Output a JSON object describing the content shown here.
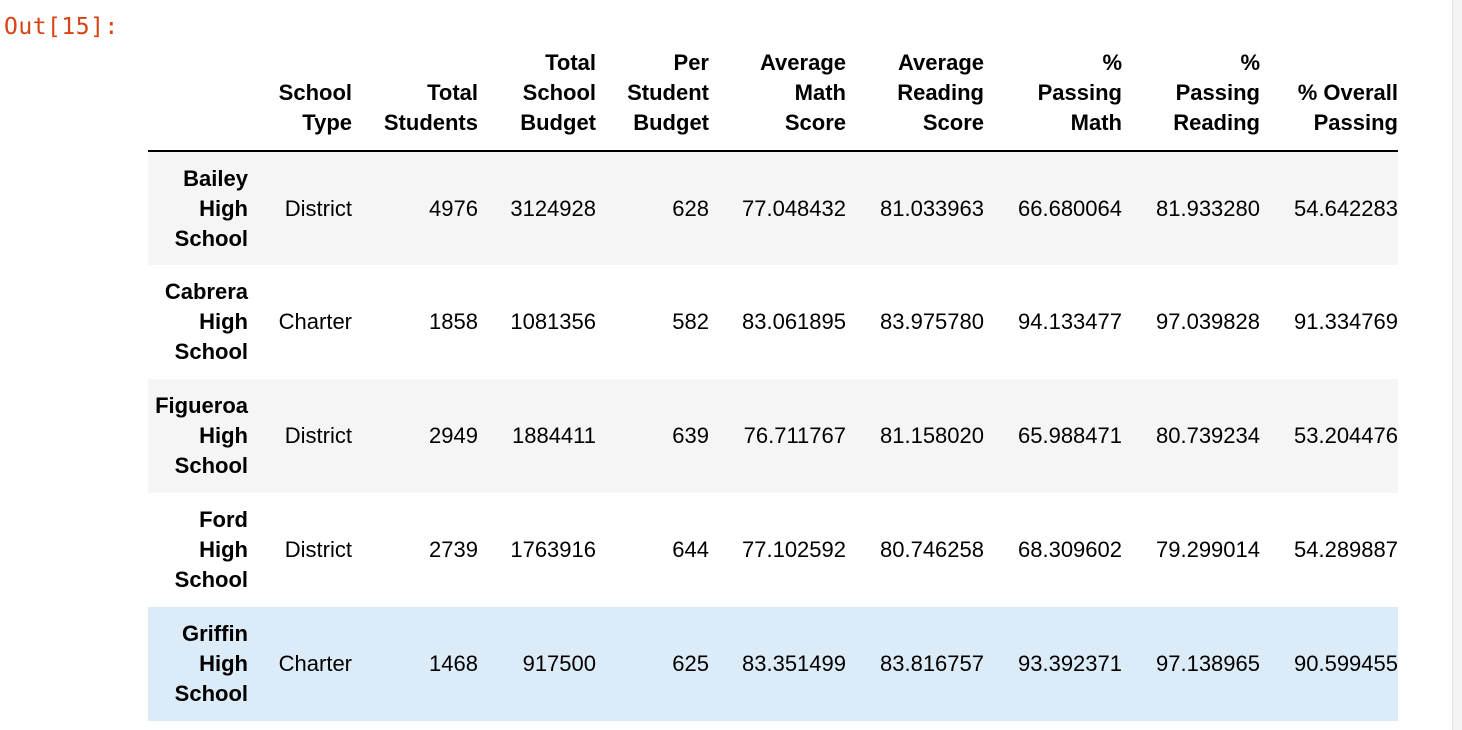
{
  "prompt": "Out[15]:",
  "table": {
    "columns": [
      [
        "School",
        "Type"
      ],
      [
        "Total",
        "Students"
      ],
      [
        "Total",
        "School",
        "Budget"
      ],
      [
        "Per",
        "Student",
        "Budget"
      ],
      [
        "Average",
        "Math",
        "Score"
      ],
      [
        "Average",
        "Reading",
        "Score"
      ],
      [
        "%",
        "Passing",
        "Math"
      ],
      [
        "%",
        "Passing",
        "Reading"
      ],
      [
        "% Overall",
        "Passing"
      ]
    ],
    "rows": [
      {
        "index": [
          "Bailey",
          "High",
          "School"
        ],
        "values": [
          "District",
          "4976",
          "3124928",
          "628",
          "77.048432",
          "81.033963",
          "66.680064",
          "81.933280",
          "54.642283"
        ]
      },
      {
        "index": [
          "Cabrera",
          "High",
          "School"
        ],
        "values": [
          "Charter",
          "1858",
          "1081356",
          "582",
          "83.061895",
          "83.975780",
          "94.133477",
          "97.039828",
          "91.334769"
        ]
      },
      {
        "index": [
          "Figueroa",
          "High",
          "School"
        ],
        "values": [
          "District",
          "2949",
          "1884411",
          "639",
          "76.711767",
          "81.158020",
          "65.988471",
          "80.739234",
          "53.204476"
        ]
      },
      {
        "index": [
          "Ford",
          "High",
          "School"
        ],
        "values": [
          "District",
          "2739",
          "1763916",
          "644",
          "77.102592",
          "80.746258",
          "68.309602",
          "79.299014",
          "54.289887"
        ]
      },
      {
        "index": [
          "Griffin",
          "High",
          "School"
        ],
        "values": [
          "Charter",
          "1468",
          "917500",
          "625",
          "83.351499",
          "83.816757",
          "93.392371",
          "97.138965",
          "90.599455"
        ]
      }
    ]
  }
}
